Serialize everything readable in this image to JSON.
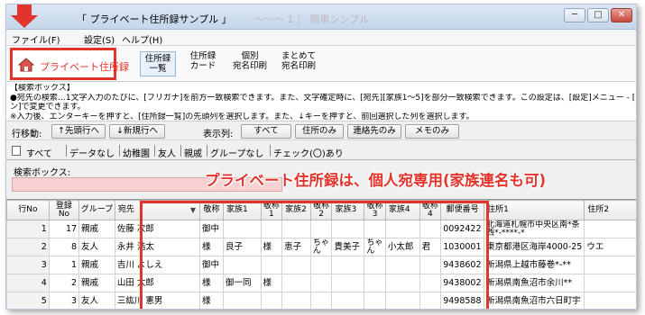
{
  "window": {
    "title": "「 プライベート住所録サンプル 」",
    "title_ghost": "〜〜〜 1 〕   簡単シンプル",
    "controls": [
      "─",
      "□",
      "✕"
    ]
  },
  "menu": [
    {
      "label": "ファイル(F)"
    },
    {
      "label": "設定(S)"
    },
    {
      "label": "ヘルプ(H)"
    }
  ],
  "toolbar": {
    "home_label": "プライベート住所録",
    "buttons": [
      {
        "line1": "住所録",
        "line2": "一覧"
      },
      {
        "line1": "住所録",
        "line2": "カード"
      },
      {
        "line1": "個別",
        "line2": "宛名印刷"
      },
      {
        "line1": "まとめて",
        "line2": "宛名印刷"
      }
    ]
  },
  "info": {
    "lines": [
      "【検索ボックス】",
      "●宛先の検索…1文字入力のたびに、[フリガナ]を前方一致検索できます。また、文字確定時に、[宛先][家族1〜5]を部分一致検索できます。この設定は、[設定]メニュー ‐ [オプショ",
      "ン]で変更できます。",
      "※入力後、エンターキーを押すと、[住所録一覧]の先頭列を選択します。また、↓キーを押すと、前回選択した列を選択します。"
    ]
  },
  "nav": {
    "row_move_label": "行移動:",
    "first_row_btn": "↑先頭行へ",
    "new_row_btn": "↓新規行へ",
    "display_label": "表示列:",
    "col_buttons": [
      "すべて",
      "住所のみ",
      "連絡先のみ",
      "メモのみ"
    ]
  },
  "tabs": [
    "すべて",
    "データなし",
    "幼稚園",
    "友人",
    "親戚",
    "グループなし",
    "チェック(〇)あり"
  ],
  "search": {
    "label": "検索ボックス:",
    "value": ""
  },
  "callout": "プライベート住所録は、個人宛専用(家族連名も可)",
  "grid": {
    "headers": [
      "行No",
      "登録\nNo",
      "グループ",
      "宛先",
      "敬称",
      "家族1",
      "敬称\n1",
      "家族2",
      "敬称\n2",
      "家族3",
      "敬称\n3",
      "家族4",
      "敬称\n4",
      "郵便番号",
      "住所1",
      "住所2"
    ],
    "rows": [
      [
        "1",
        "17",
        "親戚",
        "佐藤 次郎",
        "御中",
        "",
        "",
        "",
        "",
        "",
        "",
        "",
        "",
        "0092422",
        "北海道札幌市中央区南*条西*-****-*",
        ""
      ],
      [
        "2",
        "8",
        "友人",
        "永井 浩太",
        "様",
        "良子",
        "様",
        "恵子",
        "ちゃん",
        "貴美子",
        "ちゃん",
        "小太郎",
        "君",
        "1030001",
        "東京都港区海岸4000-25",
        "ウエ"
      ],
      [
        "3",
        "1",
        "親戚",
        "吉川 よしえ",
        "御中",
        "",
        "",
        "",
        "",
        "",
        "",
        "",
        "",
        "9438602",
        "新潟県上越市藤巻*-**",
        ""
      ],
      [
        "4",
        "2",
        "親戚",
        "山田 太郎",
        "様",
        "御一同",
        "様",
        "",
        "",
        "",
        "",
        "",
        "",
        "9438002",
        "新潟県南魚沼市余川**",
        ""
      ],
      [
        "5",
        "3",
        "友人",
        "三紘川 憲男",
        "様",
        "",
        "",
        "",
        "",
        "",
        "",
        "",
        "",
        "9498588",
        "新潟県南魚沼市六日町宇",
        ""
      ]
    ]
  },
  "colors": {
    "accent_red": "#e3342c",
    "search_bg": "#f8d2d2"
  }
}
